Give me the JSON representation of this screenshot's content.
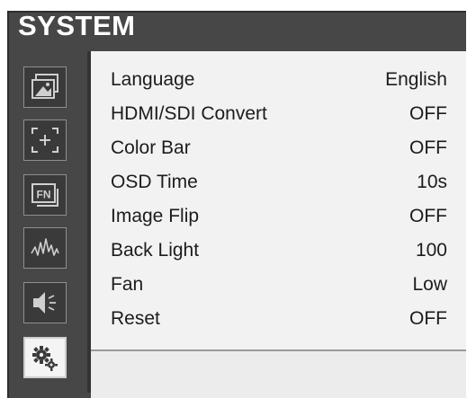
{
  "header": {
    "title": "SYSTEM"
  },
  "sidebar": {
    "icons": [
      "picture-icon",
      "focus-frame-icon",
      "fn-icon",
      "waveform-icon",
      "speaker-icon",
      "gears-icon"
    ],
    "active": "gears-icon"
  },
  "menu": {
    "rows": [
      {
        "label": "Language",
        "value": "English"
      },
      {
        "label": "HDMI/SDI Convert",
        "value": "OFF"
      },
      {
        "label": "Color Bar",
        "value": "OFF"
      },
      {
        "label": "OSD Time",
        "value": "10s"
      },
      {
        "label": "Image Flip",
        "value": "OFF"
      },
      {
        "label": "Back Light",
        "value": "100"
      },
      {
        "label": "Fan",
        "value": "Low"
      },
      {
        "label": "Reset",
        "value": "OFF"
      }
    ]
  },
  "colors": {
    "frame": "#474747",
    "panel": "#f2f2f2",
    "active_tab": "#f4f4f4"
  }
}
